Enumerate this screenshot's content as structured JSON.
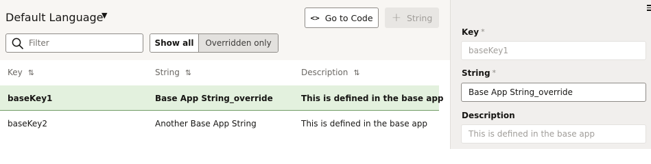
{
  "header": {
    "language_title": "Default Language",
    "language_caret": "▼",
    "goto_code_icon": "<>",
    "goto_code_label": "Go to Code",
    "add_string_icon": "+",
    "add_string_label": "String"
  },
  "filter": {
    "placeholder": "Filter",
    "value": ""
  },
  "toggle": {
    "show_all": "Show all",
    "overridden_only": "Overridden only",
    "selected": "Show all"
  },
  "table": {
    "columns": [
      {
        "label": "Key",
        "sort_icon": "⇅"
      },
      {
        "label": "String",
        "sort_icon": "⇅"
      },
      {
        "label": "Description",
        "sort_icon": "⇅"
      }
    ],
    "rows": [
      {
        "key": "baseKey1",
        "string": "Base App String_override",
        "description": "This is defined in the base app",
        "selected": true
      },
      {
        "key": "baseKey2",
        "string": "Another Base App String",
        "description": "This is defined in the base app",
        "selected": false
      }
    ]
  },
  "panel": {
    "menu_icon": "hamburger-icon",
    "key_label": "Key",
    "key_value": "baseKey1",
    "string_label": "String",
    "string_value": "Base App String_override",
    "description_label": "Description",
    "description_value": "This is defined in the base app",
    "required_mark": "*"
  },
  "colors": {
    "selected_row_bg": "#e3f1de",
    "selected_row_border": "#6f9a63",
    "panel_bg": "#f1efed",
    "toolbar_bg": "#f8f6f3"
  }
}
